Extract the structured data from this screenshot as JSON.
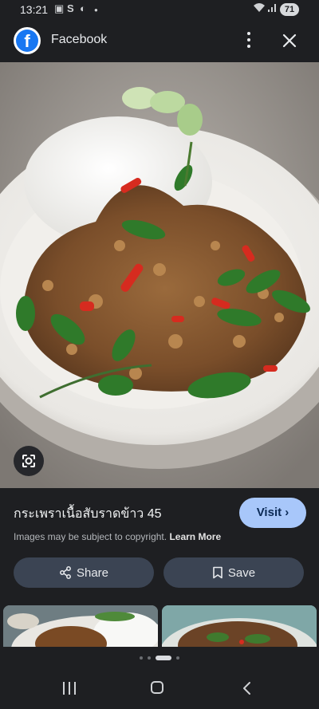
{
  "status_bar": {
    "time": "13:21",
    "notification_icons": [
      "gallery-icon",
      "skype-icon",
      "s-icon",
      "dnd-icon",
      "dot-icon"
    ],
    "battery": "71"
  },
  "top_bar": {
    "app_name": "Facebook",
    "logo_letter": "f",
    "brand_color": "#1877f2"
  },
  "image": {
    "title": "กระเพราเนื้อสับราดข้าว 45",
    "copyright_text": "Images may be subject to copyright.",
    "learn_more": "Learn More"
  },
  "actions": {
    "visit_label": "Visit",
    "share_label": "Share",
    "save_label": "Save"
  },
  "pager": {
    "count": 4,
    "active_index": 2
  },
  "colors": {
    "background": "#1e1f22",
    "visit_button": "#a8c7fa",
    "secondary_button": "#3b4453"
  }
}
